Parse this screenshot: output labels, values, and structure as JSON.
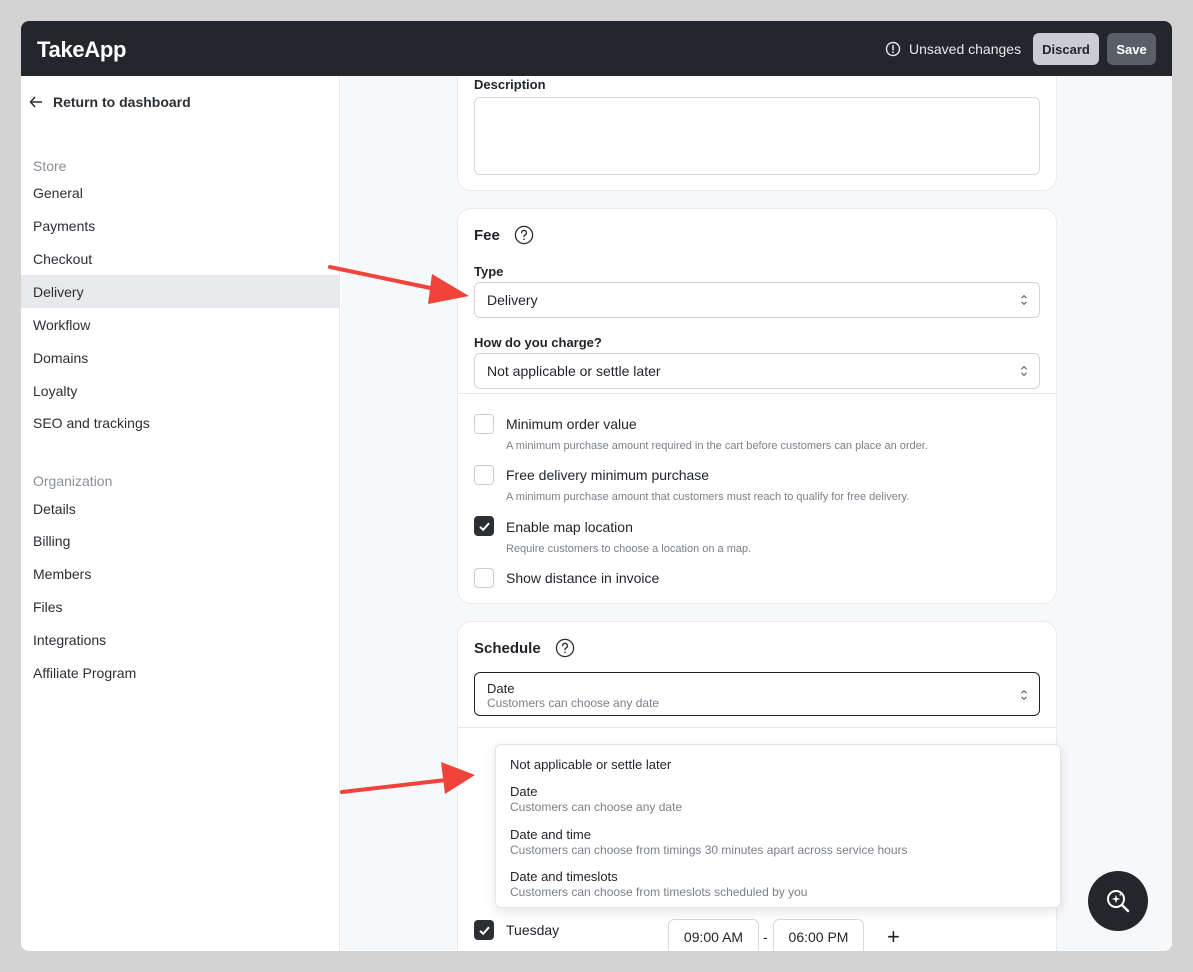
{
  "topbar": {
    "brand": "TakeApp",
    "unsaved_text": "Unsaved changes",
    "discard_label": "Discard",
    "save_label": "Save"
  },
  "sidebar": {
    "back_label": "Return to dashboard",
    "store_label": "Store",
    "store_items": [
      "General",
      "Payments",
      "Checkout",
      "Delivery",
      "Workflow",
      "Domains",
      "Loyalty",
      "SEO and trackings"
    ],
    "active_item": "Delivery",
    "org_label": "Organization",
    "org_items": [
      "Details",
      "Billing",
      "Members",
      "Files",
      "Integrations",
      "Affiliate Program"
    ]
  },
  "description": {
    "label": "Description",
    "value": ""
  },
  "fee": {
    "heading": "Fee",
    "type_label": "Type",
    "type_value": "Delivery",
    "charge_label": "How do you charge?",
    "charge_value": "Not applicable or settle later",
    "options": [
      {
        "label": "Minimum order value",
        "desc": "A minimum purchase amount required in the cart before customers can place an order.",
        "checked": false
      },
      {
        "label": "Free delivery minimum purchase",
        "desc": "A minimum purchase amount that customers must reach to qualify for free delivery.",
        "checked": false
      },
      {
        "label": "Enable map location",
        "desc": "Require customers to choose a location on a map.",
        "checked": true
      },
      {
        "label": "Show distance in invoice",
        "desc": "",
        "checked": false
      }
    ]
  },
  "schedule": {
    "heading": "Schedule",
    "selected_value": "Date",
    "selected_desc": "Customers can choose any date",
    "dropdown_options": [
      {
        "title": "Not applicable or settle later",
        "desc": ""
      },
      {
        "title": "Date",
        "desc": "Customers can choose any date"
      },
      {
        "title": "Date and time",
        "desc": "Customers can choose from timings 30 minutes apart across service hours"
      },
      {
        "title": "Date and timeslots",
        "desc": "Customers can choose from timeslots scheduled by you"
      }
    ],
    "day": {
      "label": "Tuesday",
      "checked": true,
      "start": "09:00 AM",
      "separator": "-",
      "end": "06:00 PM",
      "add": "+"
    }
  },
  "colors": {
    "topbar": "#23262b",
    "annotation_arrow": "#f0443a",
    "active_nav": "#e8e9ec"
  }
}
